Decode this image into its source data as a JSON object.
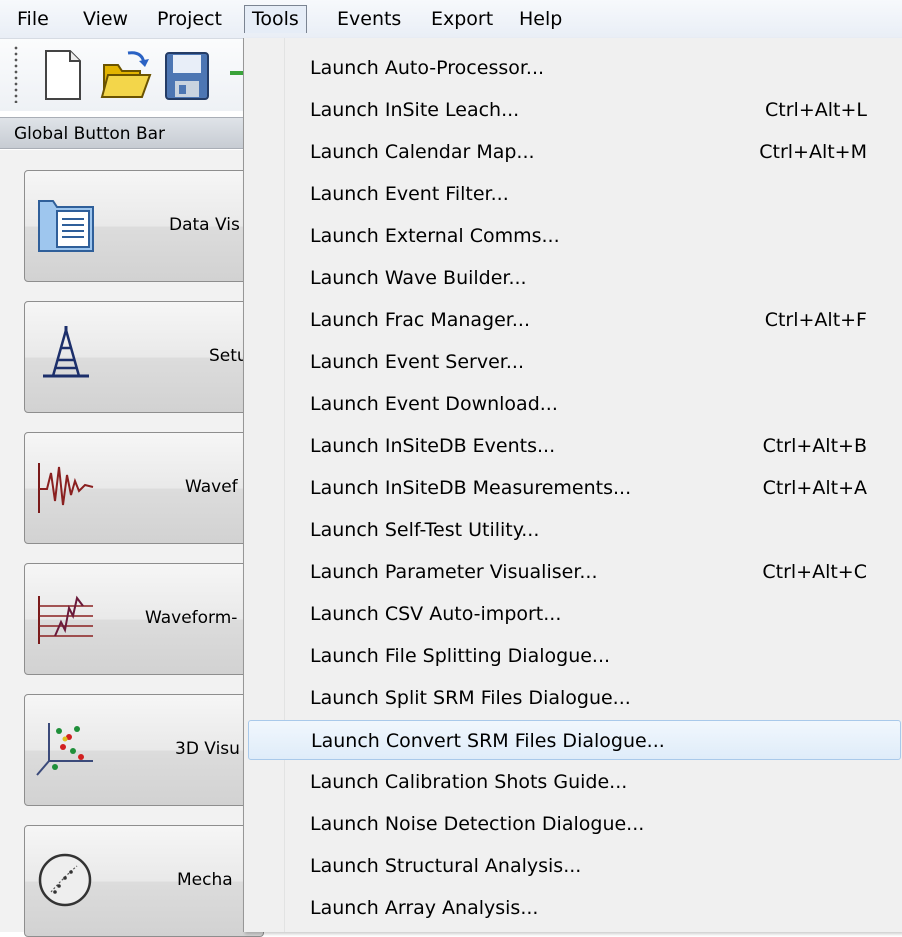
{
  "menubar": {
    "items": [
      {
        "label": "File"
      },
      {
        "label": "View"
      },
      {
        "label": "Project"
      },
      {
        "label": "Tools"
      },
      {
        "label": "Events"
      },
      {
        "label": "Export"
      },
      {
        "label": "Help"
      }
    ],
    "active_item": "Tools"
  },
  "toolbar": {
    "buttons": [
      {
        "icon": "new-document-icon"
      },
      {
        "icon": "open-folder-icon"
      },
      {
        "icon": "save-disk-icon"
      }
    ]
  },
  "global_button_bar": {
    "title": "Global Button Bar",
    "buttons": [
      {
        "label": "Data Vis",
        "icon": "folder-document-icon"
      },
      {
        "label": "Setu",
        "icon": "drilling-rig-icon"
      },
      {
        "label": "Wavef",
        "icon": "waveform-icon"
      },
      {
        "label": "Waveform-",
        "icon": "multi-waveform-icon"
      },
      {
        "label": "3D Visu",
        "icon": "scatter-3d-icon"
      },
      {
        "label": "Mecha",
        "icon": "stereonet-icon"
      }
    ]
  },
  "tools_menu": {
    "items": [
      {
        "label": "Launch Auto-Processor...",
        "shortcut": ""
      },
      {
        "label": "Launch InSite Leach...",
        "shortcut": "Ctrl+Alt+L"
      },
      {
        "label": "Launch Calendar Map...",
        "shortcut": "Ctrl+Alt+M"
      },
      {
        "label": "Launch Event Filter...",
        "shortcut": ""
      },
      {
        "label": "Launch External Comms...",
        "shortcut": ""
      },
      {
        "label": "Launch Wave Builder...",
        "shortcut": ""
      },
      {
        "label": "Launch Frac Manager...",
        "shortcut": "Ctrl+Alt+F"
      },
      {
        "label": "Launch Event Server...",
        "shortcut": ""
      },
      {
        "label": "Launch Event Download...",
        "shortcut": ""
      },
      {
        "label": "Launch InSiteDB Events...",
        "shortcut": "Ctrl+Alt+B"
      },
      {
        "label": "Launch InSiteDB Measurements...",
        "shortcut": "Ctrl+Alt+A"
      },
      {
        "label": "Launch Self-Test Utility...",
        "shortcut": ""
      },
      {
        "label": "Launch Parameter Visualiser...",
        "shortcut": "Ctrl+Alt+C"
      },
      {
        "label": "Launch CSV Auto-import...",
        "shortcut": ""
      },
      {
        "label": "Launch File Splitting Dialogue...",
        "shortcut": ""
      },
      {
        "label": "Launch Split SRM Files Dialogue...",
        "shortcut": ""
      },
      {
        "label": "Launch Convert SRM Files Dialogue...",
        "shortcut": ""
      },
      {
        "label": "Launch Calibration Shots Guide...",
        "shortcut": ""
      },
      {
        "label": "Launch Noise Detection Dialogue...",
        "shortcut": ""
      },
      {
        "label": "Launch Structural Analysis...",
        "shortcut": ""
      },
      {
        "label": "Launch Array Analysis...",
        "shortcut": ""
      }
    ],
    "highlighted_item": "Launch Convert SRM Files Dialogue..."
  }
}
